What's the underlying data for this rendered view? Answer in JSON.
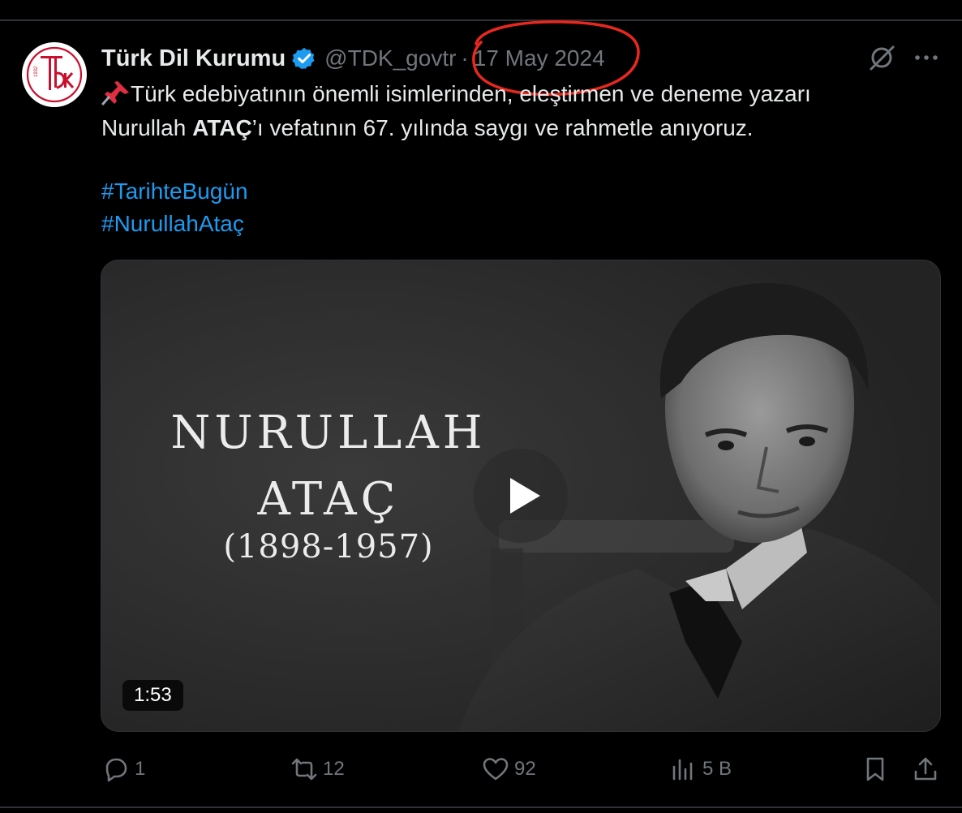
{
  "tweet": {
    "display_name": "Türk Dil Kurumu",
    "handle": "@TDK_govtr",
    "separator": "·",
    "timestamp": "17 May 2024",
    "avatar_icon": "tdk-logo-icon",
    "avatar_logo_year": "1932",
    "avatar_logo_letters": "TDK",
    "verified_icon": "verified-badge-icon",
    "text_line1": "Türk edebiyatının önemli isimlerinden, eleştirmen ve deneme yazarı",
    "text_line2_before": "Nurullah ",
    "text_line2_bold": "ATAÇ",
    "text_line2_after": "’ı vefatının 67. yılında saygı ve rahmetle anıyoruz.",
    "pin_icon": "pushpin-icon",
    "hashtags": [
      "#TarihteBugün",
      "#NurullahAtaç"
    ]
  },
  "media": {
    "overlay_line1": "NURULLAH",
    "overlay_line2": "ATAÇ",
    "overlay_years": "(1898-1957)",
    "duration": "1:53",
    "play_icon": "play-icon"
  },
  "actions": {
    "reply_count": "1",
    "repost_count": "12",
    "like_count": "92",
    "views_count": "5 B",
    "icons": [
      "reply-icon",
      "repost-icon",
      "like-icon",
      "views-icon",
      "bookmark-icon",
      "share-icon"
    ]
  },
  "colors": {
    "background": "#000000",
    "text": "#e7e9ea",
    "muted": "#71767b",
    "link": "#1d9bf0",
    "verified": "#1d9bf0",
    "annotation": "#e8281e",
    "logo_red": "#c8102e"
  }
}
